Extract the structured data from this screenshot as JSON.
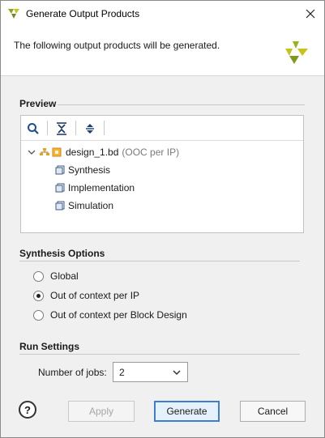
{
  "window": {
    "title": "Generate Output Products"
  },
  "header": {
    "description": "The following output products will be generated."
  },
  "preview": {
    "section_title": "Preview",
    "tree": {
      "root": {
        "label": "design_1.bd",
        "note": "(OOC per IP)",
        "expanded": true
      },
      "children": [
        {
          "label": "Synthesis"
        },
        {
          "label": "Implementation"
        },
        {
          "label": "Simulation"
        }
      ]
    }
  },
  "synthesis_options": {
    "section_title": "Synthesis Options",
    "options": [
      {
        "label": "Global",
        "selected": false
      },
      {
        "label": "Out of context per IP",
        "selected": true
      },
      {
        "label": "Out of context per Block Design",
        "selected": false
      }
    ]
  },
  "run_settings": {
    "section_title": "Run Settings",
    "jobs_label": "Number of jobs:",
    "jobs_value": "2"
  },
  "buttons": {
    "help": "?",
    "apply": "Apply",
    "generate": "Generate",
    "cancel": "Cancel"
  },
  "colors": {
    "brand": "#c8c21a",
    "primary_border": "#3c7fd1",
    "dialog_bg": "#f0f0f0"
  }
}
